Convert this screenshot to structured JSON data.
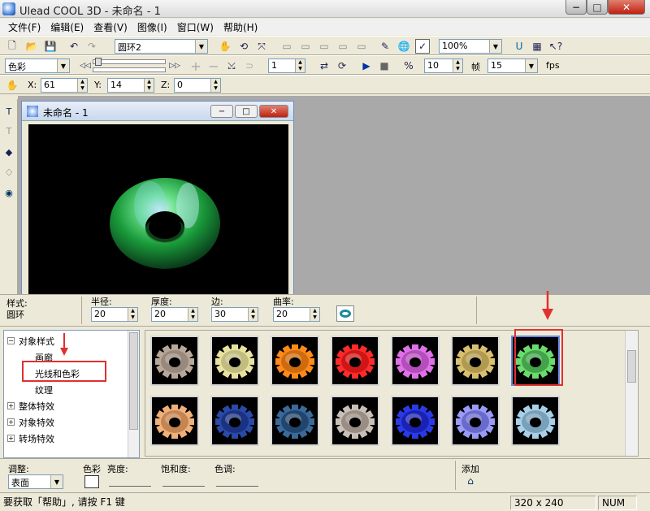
{
  "window": {
    "title": "Ulead COOL 3D - 未命名 - 1"
  },
  "menu": [
    "文件(F)",
    "编辑(E)",
    "查看(V)",
    "图像(I)",
    "窗口(W)",
    "帮助(H)"
  ],
  "toolbar1": {
    "object_combo": "圆环2",
    "zoom_combo": "100%"
  },
  "toolbar2": {
    "color_combo": "色彩",
    "frame_value": "1",
    "fps_value": "10",
    "frame_label": "帧",
    "frames_combo": "15",
    "fps_label": "fps"
  },
  "toolbar3": {
    "x_label": "X:",
    "x_value": "61",
    "y_label": "Y:",
    "y_value": "14",
    "z_label": "Z:",
    "z_value": "0"
  },
  "document": {
    "title": "未命名 - 1"
  },
  "properties": {
    "style_label": "样式:",
    "style_value": "圆环",
    "radius_label": "半径:",
    "radius_value": "20",
    "thickness_label": "厚度:",
    "thickness_value": "20",
    "sides_label": "边:",
    "sides_value": "30",
    "curvature_label": "曲率:",
    "curvature_value": "20"
  },
  "tree": {
    "root": "对象样式",
    "children": [
      "画廊",
      "光线和色彩",
      "纹理"
    ],
    "others": [
      "整体特效",
      "对象特效",
      "转场特效"
    ]
  },
  "gallery": {
    "thumbs_row1": [
      {
        "color": "#b8a89a",
        "glow": "#7a6a5e"
      },
      {
        "color": "#e8e2a0",
        "glow": "#9a9660"
      },
      {
        "color": "#ff8a1a",
        "glow": "#a04a00"
      },
      {
        "color": "#ff2a2a",
        "glow": "#a00000"
      },
      {
        "color": "#e070e8",
        "glow": "#8a2a90"
      },
      {
        "color": "#d8c070",
        "glow": "#8a7430"
      },
      {
        "color": "#6adc6a",
        "glow": "#1a6a2a"
      }
    ],
    "thumbs_row2": [
      {
        "color": "#f0b07a",
        "glow": "#9a5a2a"
      },
      {
        "color": "#2a4aa8",
        "glow": "#0a1a5a"
      },
      {
        "color": "#3a6a9a",
        "glow": "#0a2040"
      },
      {
        "color": "#c8c0b8",
        "glow": "#6a5a50"
      },
      {
        "color": "#2a3ae8",
        "glow": "#0a0a80"
      },
      {
        "color": "#9a9af8",
        "glow": "#3a3aa0"
      },
      {
        "color": "#a8d0e8",
        "glow": "#4a708a"
      }
    ]
  },
  "adjust": {
    "adjust_label": "调整:",
    "surface_combo": "表面",
    "color_label": "色彩",
    "brightness_label": "亮度:",
    "saturation_label": "饱和度:",
    "hue_label": "色调:",
    "add_label": "添加"
  },
  "status": {
    "hint": "要获取「帮助」, 请按 F1 键",
    "size": "320 x 240",
    "num": "NUM"
  },
  "colors": {
    "accent_red": "#e03030",
    "window_bg": "#ece9d8",
    "workspace_bg": "#a9a9a9"
  }
}
